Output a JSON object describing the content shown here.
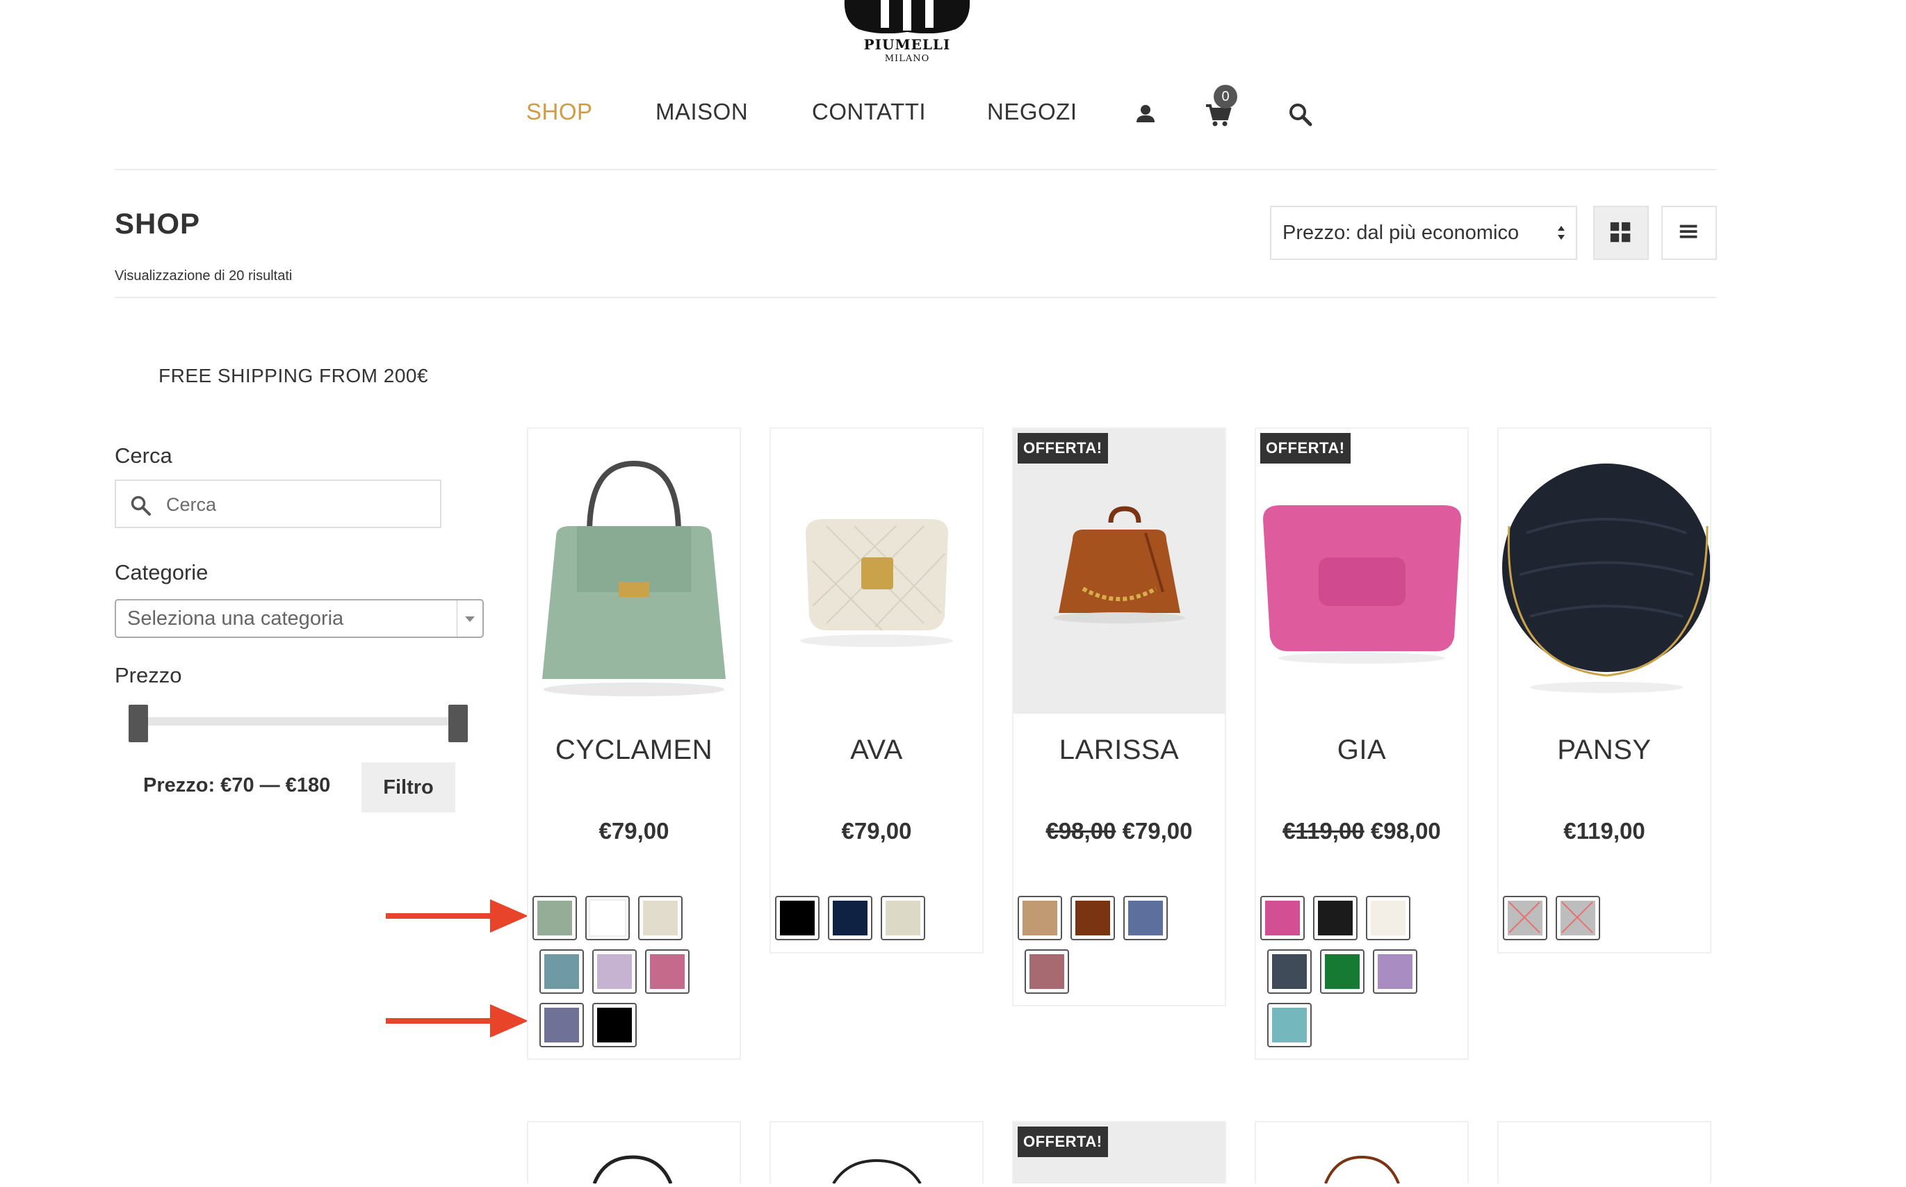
{
  "brand": {
    "name": "PIUMELLI",
    "city": "MILANO",
    "icon": "logo-emblem"
  },
  "nav": {
    "items": [
      {
        "label": "SHOP",
        "active": true
      },
      {
        "label": "MAISON"
      },
      {
        "label": "CONTATTI"
      },
      {
        "label": "NEGOZI"
      }
    ],
    "account_icon": "user-icon",
    "cart_icon": "cart-icon",
    "cart_count": "0",
    "search_icon": "search-icon",
    "accent_color": "#d19a45"
  },
  "shop": {
    "title": "SHOP",
    "results_text": "Visualizzazione di 20 risultati",
    "sort_selected": "Prezzo: dal più economico",
    "free_shipping": "FREE SHIPPING FROM 200€"
  },
  "sidebar": {
    "search_title": "Cerca",
    "search_placeholder": "Cerca",
    "category_title": "Categorie",
    "category_selected": "Seleziona una categoria",
    "price_title": "Prezzo",
    "price_range_label": "Prezzo: €70 — €180",
    "price_min": 70,
    "price_max": 180,
    "filter_label": "Filtro"
  },
  "products": [
    {
      "name": "CYCLAMEN",
      "price": "€79,00",
      "old_price": "",
      "badge": "",
      "swatches": [
        "#95ac97",
        "#ffffff",
        "#e1dccb",
        "#7099a6",
        "#c6b3d2",
        "#c66a8b",
        "#6f7296",
        "#000000"
      ]
    },
    {
      "name": "AVA",
      "price": "€79,00",
      "old_price": "",
      "badge": "",
      "swatches": [
        "#000000",
        "#0f2244",
        "#ddd9c7"
      ]
    },
    {
      "name": "LARISSA",
      "price": "€79,00",
      "old_price": "€98,00",
      "badge": "OFFERTA!",
      "swatches": [
        "#c19a73",
        "#7a3411",
        "#5c6f9d",
        "#a86a71"
      ]
    },
    {
      "name": "GIA",
      "price": "€98,00",
      "old_price": "€119,00",
      "badge": "OFFERTA!",
      "swatches": [
        "#d34f93",
        "#1b1b1b",
        "#f3efe6",
        "#3f4b58",
        "#167a34",
        "#a88cc2",
        "#74b8bd"
      ]
    },
    {
      "name": "PANSY",
      "price": "€119,00",
      "old_price": "",
      "badge": "",
      "swatches": [
        "#bdbdbd",
        "#bdbdbd"
      ]
    }
  ],
  "next_row_badge": "OFFERTA!",
  "annotation_color": "#e8442a"
}
